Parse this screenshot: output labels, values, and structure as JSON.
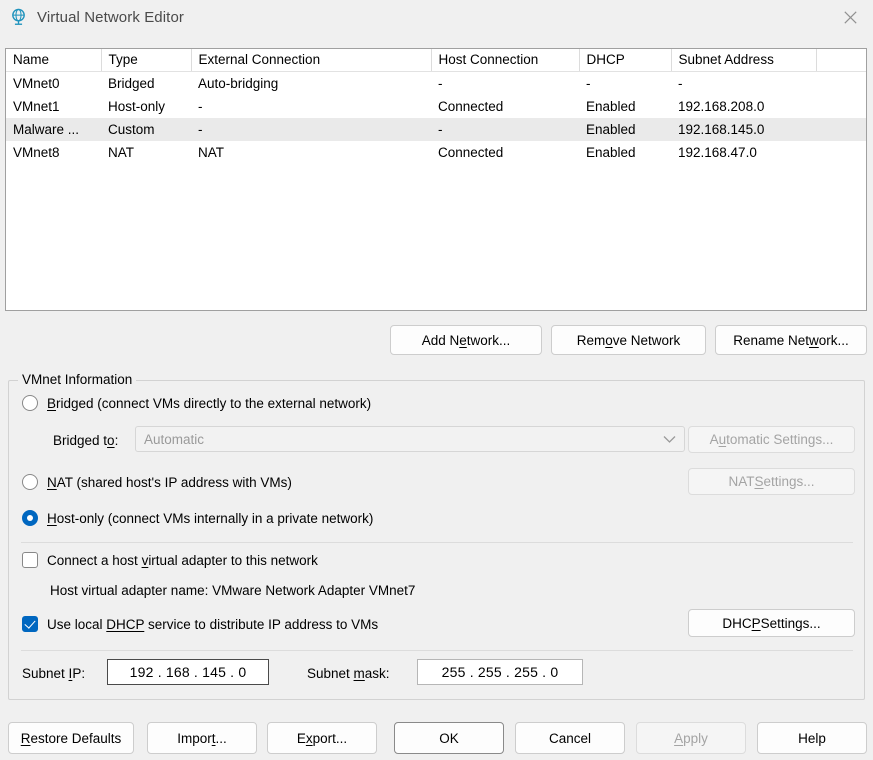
{
  "window": {
    "title": "Virtual Network Editor",
    "icon": "network-globe-icon",
    "close_label": "close-icon",
    "accent_color": "#0067c0",
    "icon_color": "#2196bd"
  },
  "network_list": {
    "columns": [
      "Name",
      "Type",
      "External Connection",
      "Host Connection",
      "DHCP",
      "Subnet Address"
    ],
    "rows": [
      {
        "name": "VMnet0",
        "type": "Bridged",
        "external_connection": "Auto-bridging",
        "host_connection": "-",
        "dhcp": "-",
        "subnet_address": "-",
        "selected": false
      },
      {
        "name": "VMnet1",
        "type": "Host-only",
        "external_connection": "-",
        "host_connection": "Connected",
        "dhcp": "Enabled",
        "subnet_address": "192.168.208.0",
        "selected": false
      },
      {
        "name": "Malware ...",
        "type": "Custom",
        "external_connection": "-",
        "host_connection": "-",
        "dhcp": "Enabled",
        "subnet_address": "192.168.145.0",
        "selected": true
      },
      {
        "name": "VMnet8",
        "type": "NAT",
        "external_connection": "NAT",
        "host_connection": "Connected",
        "dhcp": "Enabled",
        "subnet_address": "192.168.47.0",
        "selected": false
      }
    ]
  },
  "list_actions": {
    "add": {
      "pre": "Add N",
      "mnemonic": "e",
      "post": "twork..."
    },
    "remove": {
      "pre": "Rem",
      "mnemonic": "o",
      "post": "ve Network"
    },
    "rename": {
      "pre": "Rename Net",
      "mnemonic": "w",
      "post": "ork..."
    }
  },
  "vmnet_info": {
    "group_title": "VMnet Information",
    "bridged": {
      "pre": "",
      "mnemonic": "B",
      "post": "ridged (connect VMs directly to the external network)",
      "selected": false
    },
    "bridged_to_label": {
      "pre": "Bridged t",
      "mnemonic": "o",
      "post": ":"
    },
    "bridged_to_value": "Automatic",
    "bridged_to_enabled": false,
    "automatic_settings": {
      "pre": "A",
      "mnemonic": "u",
      "post": "tomatic Settings...",
      "enabled": false
    },
    "nat": {
      "pre": "",
      "mnemonic": "N",
      "post": "AT (shared host's IP address with VMs)",
      "selected": false
    },
    "nat_settings": {
      "pre": "NAT ",
      "mnemonic": "S",
      "post": "ettings...",
      "enabled": false
    },
    "host_only": {
      "pre": "",
      "mnemonic": "H",
      "post": "ost-only (connect VMs internally in a private network)",
      "selected": true
    },
    "connect_host_adapter": {
      "pre": "Connect a host ",
      "mnemonic": "v",
      "post": "irtual adapter to this network",
      "checked": false
    },
    "host_adapter_name": "Host virtual adapter name: VMware Network Adapter VMnet7",
    "use_local_dhcp": {
      "pre": "Use local ",
      "mnemonic": "DHCP",
      "post": " service to distribute IP address to VMs",
      "checked": true
    },
    "dhcp_settings": {
      "pre": "DHC",
      "mnemonic": "P",
      "post": " Settings...",
      "enabled": true
    },
    "subnet_ip_label": {
      "pre": "Subnet ",
      "mnemonic": "I",
      "post": "P:"
    },
    "subnet_ip_value": "192 . 168 . 145 .   0",
    "subnet_mask_label": {
      "pre": "Subnet ",
      "mnemonic": "m",
      "post": "ask:"
    },
    "subnet_mask_value": "255 . 255 . 255 .   0"
  },
  "dialog_buttons": {
    "restore_defaults": {
      "pre": "",
      "mnemonic": "R",
      "post": "estore Defaults",
      "enabled": true
    },
    "import": {
      "pre": "Impor",
      "mnemonic": "t",
      "post": "...",
      "enabled": true
    },
    "export": {
      "pre": "E",
      "mnemonic": "x",
      "post": "port...",
      "enabled": true
    },
    "ok": {
      "pre": "OK",
      "mnemonic": "",
      "post": "",
      "enabled": true,
      "default": true
    },
    "cancel": {
      "pre": "Cancel",
      "mnemonic": "",
      "post": "",
      "enabled": true
    },
    "apply": {
      "pre": "",
      "mnemonic": "A",
      "post": "pply",
      "enabled": false
    },
    "help": {
      "pre": "Help",
      "mnemonic": "",
      "post": "",
      "enabled": true
    }
  }
}
